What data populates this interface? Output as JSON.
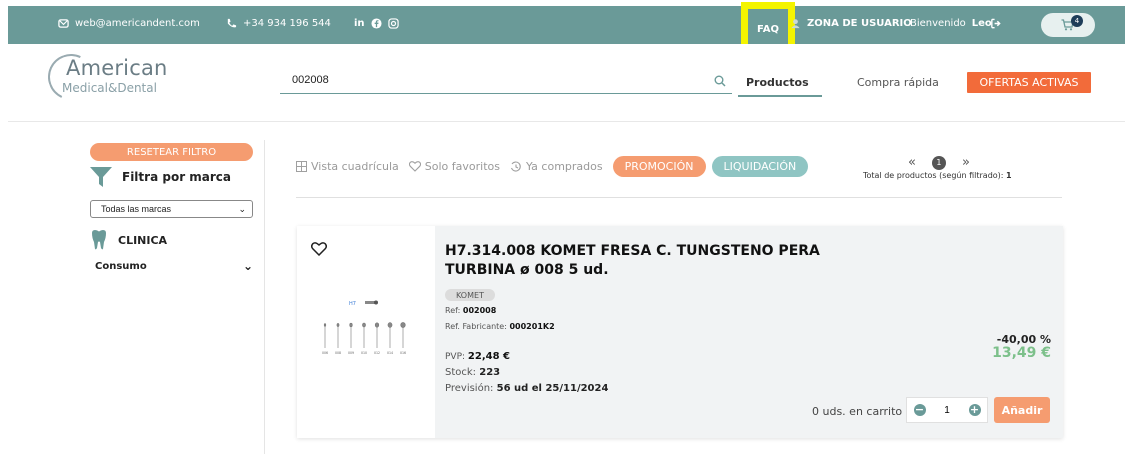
{
  "topbar": {
    "email": "web@americandent.com",
    "phone": "+34 934 196 544",
    "social_linkedin": "in",
    "faq": "FAQ",
    "user_zone": "ZONA DE USUARIO",
    "welcome": "Bienvenido",
    "user_name": "Leo",
    "cart_count": "4"
  },
  "header": {
    "logo_line1": "American",
    "logo_line2": "Medical&Dental",
    "search_value": "002008",
    "nav_productos": "Productos",
    "nav_compra": "Compra rápida",
    "ofertas": "OFERTAS ACTIVAS"
  },
  "sidebar": {
    "reset": "RESETEAR FILTRO",
    "filter_title": "Filtra por marca",
    "brand_select": "Todas las marcas",
    "category": "CLINICA",
    "subcategory": "Consumo"
  },
  "toolbar": {
    "grid_view": "Vista cuadrícula",
    "favorites": "Solo favoritos",
    "bought": "Ya comprados",
    "promo": "PROMOCIÓN",
    "liquidacion": "LIQUIDACIÓN",
    "page": "1",
    "total_label": "Total de productos (según filtrado):",
    "total_value": "1"
  },
  "product": {
    "title": "H7.314.008 KOMET FRESA C. TUNGSTENO PERA TURBINA ø 008 5 ud.",
    "brand": "KOMET",
    "ref_label": "Ref:",
    "ref_value": "002008",
    "ref_fab_label": "Ref. Fabricante:",
    "ref_fab_value": "000201K2",
    "pvp_label": "PVP:",
    "pvp_value": "22,48 €",
    "stock_label": "Stock:",
    "stock_value": "223",
    "prevision_label": "Previsión:",
    "prevision_value": "56 ud el 25/11/2024",
    "discount": "-40,00 %",
    "price": "13,49 €",
    "in_cart": "0 uds. en carrito",
    "qty": "1",
    "add": "Añadir",
    "image_code": "H7",
    "image_sizes": [
      "006",
      "008",
      "009",
      "010",
      "012",
      "014",
      "016"
    ]
  },
  "colors": {
    "topbar": "#6a9a98",
    "accent_orange": "#f26b3a",
    "promo": "#f59c70",
    "liquidacion": "#8fc5c3",
    "price_green": "#7cc08a",
    "faq_highlight": "#f4f400"
  }
}
